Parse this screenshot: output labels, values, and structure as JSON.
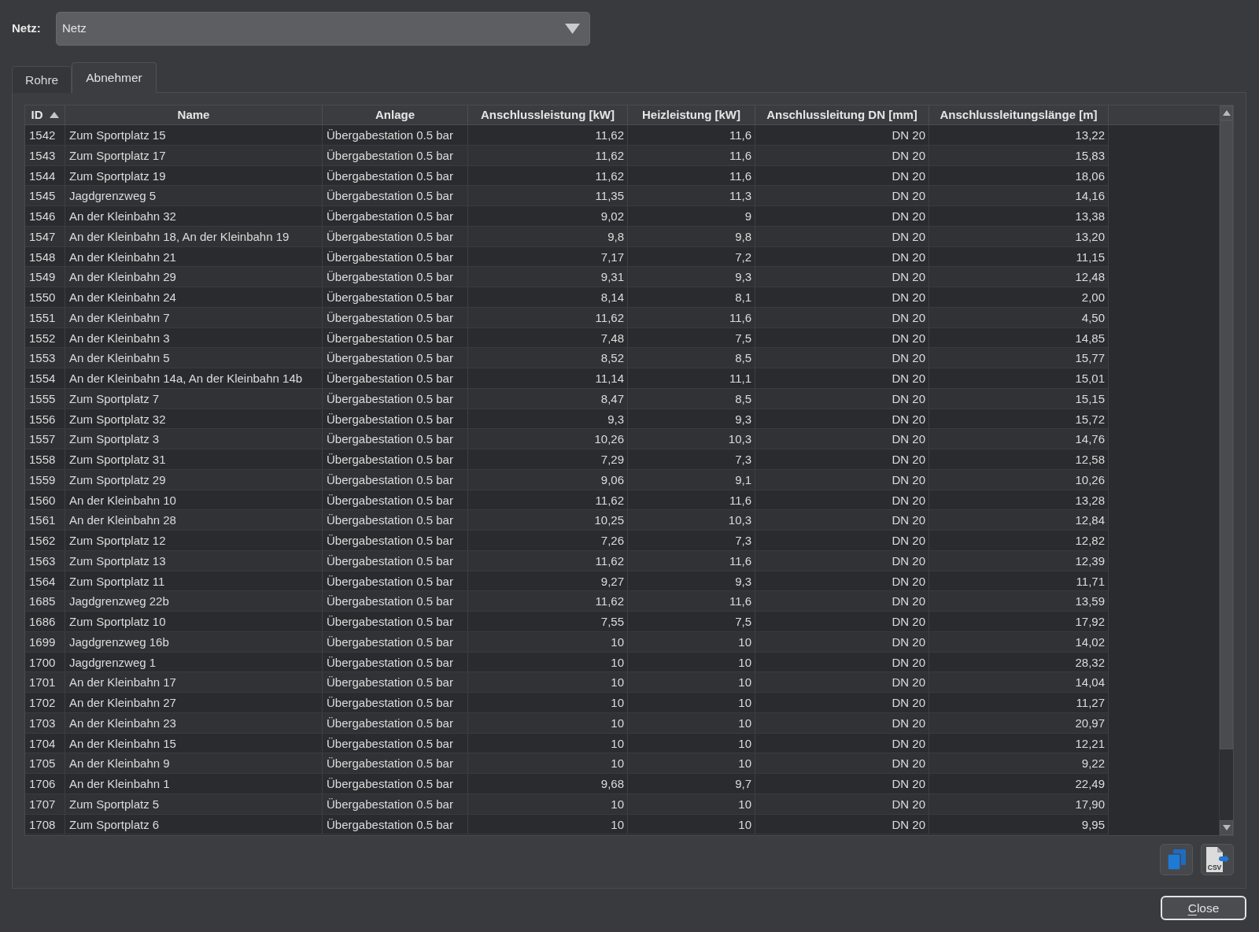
{
  "network": {
    "label": "Netz:",
    "value": "Netz"
  },
  "tabs": [
    {
      "label": "Rohre",
      "selected": false
    },
    {
      "label": "Abnehmer",
      "selected": true
    }
  ],
  "table": {
    "columns": [
      {
        "label": "ID",
        "kind": "text",
        "sorted": true
      },
      {
        "label": "Name",
        "kind": "text",
        "sorted": false
      },
      {
        "label": "Anlage",
        "kind": "text",
        "sorted": false
      },
      {
        "label": "Anschlussleistung [kW]",
        "kind": "number",
        "sorted": false
      },
      {
        "label": "Heizleistung [kW]",
        "kind": "number",
        "sorted": false
      },
      {
        "label": "Anschlussleitung DN [mm]",
        "kind": "number",
        "sorted": false
      },
      {
        "label": "Anschlussleitungslänge [m]",
        "kind": "number",
        "sorted": false
      }
    ],
    "rows": [
      [
        "1542",
        "Zum Sportplatz 15",
        "Übergabestation 0.5 bar",
        "11,62",
        "11,6",
        "DN 20",
        "13,22"
      ],
      [
        "1543",
        "Zum Sportplatz 17",
        "Übergabestation 0.5 bar",
        "11,62",
        "11,6",
        "DN 20",
        "15,83"
      ],
      [
        "1544",
        "Zum Sportplatz 19",
        "Übergabestation 0.5 bar",
        "11,62",
        "11,6",
        "DN 20",
        "18,06"
      ],
      [
        "1545",
        "Jagdgrenzweg 5",
        "Übergabestation 0.5 bar",
        "11,35",
        "11,3",
        "DN 20",
        "14,16"
      ],
      [
        "1546",
        "An der Kleinbahn 32",
        "Übergabestation 0.5 bar",
        "9,02",
        "9",
        "DN 20",
        "13,38"
      ],
      [
        "1547",
        "An der Kleinbahn 18, An der Kleinbahn 19",
        "Übergabestation 0.5 bar",
        "9,8",
        "9,8",
        "DN 20",
        "13,20"
      ],
      [
        "1548",
        "An der Kleinbahn 21",
        "Übergabestation 0.5 bar",
        "7,17",
        "7,2",
        "DN 20",
        "11,15"
      ],
      [
        "1549",
        "An der Kleinbahn 29",
        "Übergabestation 0.5 bar",
        "9,31",
        "9,3",
        "DN 20",
        "12,48"
      ],
      [
        "1550",
        "An der Kleinbahn 24",
        "Übergabestation 0.5 bar",
        "8,14",
        "8,1",
        "DN 20",
        "2,00"
      ],
      [
        "1551",
        "An der Kleinbahn 7",
        "Übergabestation 0.5 bar",
        "11,62",
        "11,6",
        "DN 20",
        "4,50"
      ],
      [
        "1552",
        "An der Kleinbahn 3",
        "Übergabestation 0.5 bar",
        "7,48",
        "7,5",
        "DN 20",
        "14,85"
      ],
      [
        "1553",
        "An der Kleinbahn 5",
        "Übergabestation 0.5 bar",
        "8,52",
        "8,5",
        "DN 20",
        "15,77"
      ],
      [
        "1554",
        "An der Kleinbahn 14a, An der Kleinbahn 14b",
        "Übergabestation 0.5 bar",
        "11,14",
        "11,1",
        "DN 20",
        "15,01"
      ],
      [
        "1555",
        "Zum Sportplatz 7",
        "Übergabestation 0.5 bar",
        "8,47",
        "8,5",
        "DN 20",
        "15,15"
      ],
      [
        "1556",
        "Zum Sportplatz 32",
        "Übergabestation 0.5 bar",
        "9,3",
        "9,3",
        "DN 20",
        "15,72"
      ],
      [
        "1557",
        "Zum Sportplatz 3",
        "Übergabestation 0.5 bar",
        "10,26",
        "10,3",
        "DN 20",
        "14,76"
      ],
      [
        "1558",
        "Zum Sportplatz 31",
        "Übergabestation 0.5 bar",
        "7,29",
        "7,3",
        "DN 20",
        "12,58"
      ],
      [
        "1559",
        "Zum Sportplatz 29",
        "Übergabestation 0.5 bar",
        "9,06",
        "9,1",
        "DN 20",
        "10,26"
      ],
      [
        "1560",
        "An der Kleinbahn 10",
        "Übergabestation 0.5 bar",
        "11,62",
        "11,6",
        "DN 20",
        "13,28"
      ],
      [
        "1561",
        "An der Kleinbahn 28",
        "Übergabestation 0.5 bar",
        "10,25",
        "10,3",
        "DN 20",
        "12,84"
      ],
      [
        "1562",
        "Zum Sportplatz 12",
        "Übergabestation 0.5 bar",
        "7,26",
        "7,3",
        "DN 20",
        "12,82"
      ],
      [
        "1563",
        "Zum Sportplatz 13",
        "Übergabestation 0.5 bar",
        "11,62",
        "11,6",
        "DN 20",
        "12,39"
      ],
      [
        "1564",
        "Zum Sportplatz 11",
        "Übergabestation 0.5 bar",
        "9,27",
        "9,3",
        "DN 20",
        "11,71"
      ],
      [
        "1685",
        "Jagdgrenzweg 22b",
        "Übergabestation 0.5 bar",
        "11,62",
        "11,6",
        "DN 20",
        "13,59"
      ],
      [
        "1686",
        "Zum Sportplatz 10",
        "Übergabestation 0.5 bar",
        "7,55",
        "7,5",
        "DN 20",
        "17,92"
      ],
      [
        "1699",
        "Jagdgrenzweg 16b",
        "Übergabestation 0.5 bar",
        "10",
        "10",
        "DN 20",
        "14,02"
      ],
      [
        "1700",
        "Jagdgrenzweg 1",
        "Übergabestation 0.5 bar",
        "10",
        "10",
        "DN 20",
        "28,32"
      ],
      [
        "1701",
        "An der Kleinbahn 17",
        "Übergabestation 0.5 bar",
        "10",
        "10",
        "DN 20",
        "14,04"
      ],
      [
        "1702",
        "An der Kleinbahn 27",
        "Übergabestation 0.5 bar",
        "10",
        "10",
        "DN 20",
        "11,27"
      ],
      [
        "1703",
        "An der Kleinbahn 23",
        "Übergabestation 0.5 bar",
        "10",
        "10",
        "DN 20",
        "20,97"
      ],
      [
        "1704",
        "An der Kleinbahn 15",
        "Übergabestation 0.5 bar",
        "10",
        "10",
        "DN 20",
        "12,21"
      ],
      [
        "1705",
        "An der Kleinbahn 9",
        "Übergabestation 0.5 bar",
        "10",
        "10",
        "DN 20",
        "9,22"
      ],
      [
        "1706",
        "An der Kleinbahn 1",
        "Übergabestation 0.5 bar",
        "9,68",
        "9,7",
        "DN 20",
        "22,49"
      ],
      [
        "1707",
        "Zum Sportplatz 5",
        "Übergabestation 0.5 bar",
        "10",
        "10",
        "DN 20",
        "17,90"
      ],
      [
        "1708",
        "Zum Sportplatz 6",
        "Übergabestation 0.5 bar",
        "10",
        "10",
        "DN 20",
        "9,95"
      ]
    ]
  },
  "table_actions": [
    {
      "kind": "copy"
    },
    {
      "kind": "csv",
      "icon_text": "CSV"
    }
  ],
  "close_button": {
    "label": "Close",
    "mnemonic_underlined": true
  }
}
